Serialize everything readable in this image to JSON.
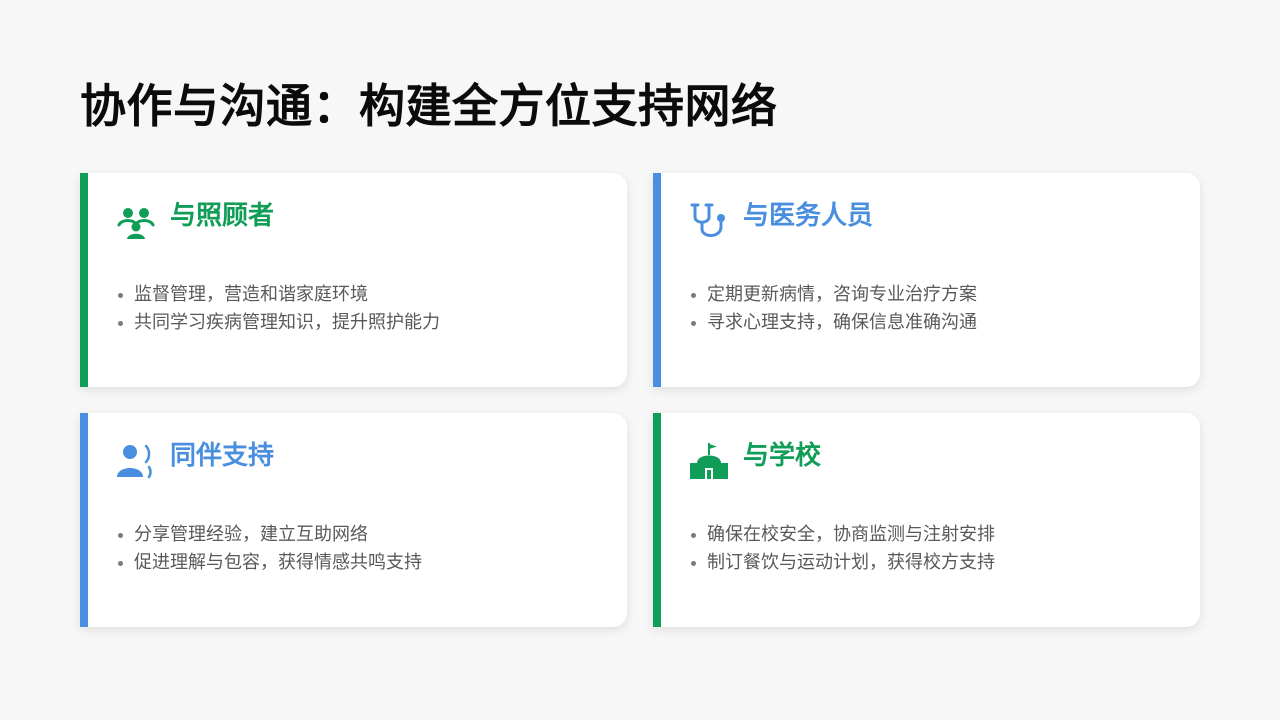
{
  "page": {
    "title": "协作与沟通：构建全方位支持网络"
  },
  "colors": {
    "green": "#0f9d58",
    "blue": "#4a8fdf",
    "background": "#f7f7f8",
    "text_body": "#595959"
  },
  "cards": [
    {
      "title": "与照顾者",
      "accent": "green",
      "icon": "people-group-icon",
      "items": [
        "监督管理，营造和谐家庭环境",
        "共同学习疾病管理知识，提升照护能力"
      ]
    },
    {
      "title": "与医务人员",
      "accent": "blue",
      "icon": "stethoscope-icon",
      "items": [
        "定期更新病情，咨询专业治疗方案",
        "寻求心理支持，确保信息准确沟通"
      ]
    },
    {
      "title": "同伴支持",
      "accent": "blue",
      "icon": "user-speaking-icon",
      "items": [
        "分享管理经验，建立互助网络",
        "促进理解与包容，获得情感共鸣支持"
      ]
    },
    {
      "title": "与学校",
      "accent": "green",
      "icon": "school-icon",
      "items": [
        "确保在校安全，协商监测与注射安排",
        "制订餐饮与运动计划，获得校方支持"
      ]
    }
  ]
}
